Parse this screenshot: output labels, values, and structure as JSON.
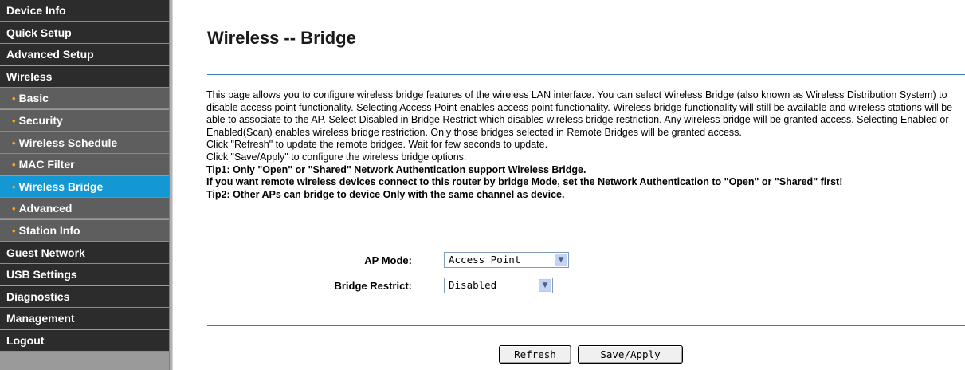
{
  "sidebar": {
    "items": [
      {
        "label": "Device Info",
        "sub": false,
        "active": false
      },
      {
        "label": "Quick Setup",
        "sub": false,
        "active": false
      },
      {
        "label": "Advanced Setup",
        "sub": false,
        "active": false
      },
      {
        "label": "Wireless",
        "sub": false,
        "active": false
      },
      {
        "label": "Basic",
        "sub": true,
        "active": false
      },
      {
        "label": "Security",
        "sub": true,
        "active": false
      },
      {
        "label": "Wireless Schedule",
        "sub": true,
        "active": false
      },
      {
        "label": "MAC Filter",
        "sub": true,
        "active": false
      },
      {
        "label": "Wireless Bridge",
        "sub": true,
        "active": true
      },
      {
        "label": "Advanced",
        "sub": true,
        "active": false
      },
      {
        "label": "Station Info",
        "sub": true,
        "active": false
      },
      {
        "label": "Guest Network",
        "sub": false,
        "active": false
      },
      {
        "label": "USB Settings",
        "sub": false,
        "active": false
      },
      {
        "label": "Diagnostics",
        "sub": false,
        "active": false
      },
      {
        "label": "Management",
        "sub": false,
        "active": false
      },
      {
        "label": "Logout",
        "sub": false,
        "active": false
      }
    ],
    "bullet": "•"
  },
  "main": {
    "title": "Wireless -- Bridge",
    "description": "This page allows you to configure wireless bridge features of the wireless LAN interface. You can select Wireless Bridge (also known as Wireless Distribution System) to disable access point functionality. Selecting Access Point enables access point functionality. Wireless bridge functionality will still be available and wireless stations will be able to associate to the AP. Select Disabled in Bridge Restrict which disables wireless bridge restriction. Any wireless bridge will be granted access. Selecting Enabled or Enabled(Scan) enables wireless bridge restriction. Only those bridges selected in Remote Bridges will be granted access.",
    "refresh_hint": "Click \"Refresh\" to update the remote bridges. Wait for few seconds to update.",
    "save_hint": "Click \"Save/Apply\" to configure the wireless bridge options.",
    "tip1": "Tip1: Only \"Open\" or \"Shared\" Network Authentication support Wireless Bridge.",
    "tip1_detail": "If you want remote wireless devices connect to this router by bridge Mode, set the Network Authentication to \"Open\" or \"Shared\" first!",
    "tip2": "Tip2: Other APs can bridge to device Only with the same channel as device."
  },
  "form": {
    "ap_mode_label": "AP Mode:",
    "ap_mode_value": "Access Point",
    "bridge_restrict_label": "Bridge Restrict:",
    "bridge_restrict_value": "Disabled"
  },
  "buttons": {
    "refresh": "Refresh",
    "save_apply": "Save/Apply"
  },
  "colors": {
    "sidebar_bg": "#2c2c2c",
    "submenu_bg": "#5e5e5e",
    "active_bg": "#1398d3",
    "bullet": "#ffa31a",
    "rule": "#3a82b4"
  }
}
